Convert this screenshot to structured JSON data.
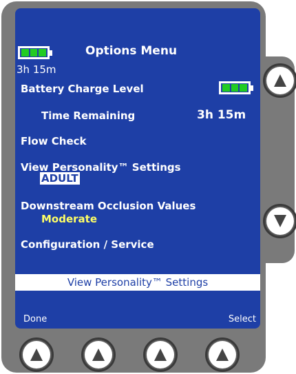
{
  "header": {
    "title": "Options Menu",
    "battery_time": "3h 15m"
  },
  "menu": {
    "battery_charge_label": "Battery Charge Level",
    "time_remaining_label": "Time Remaining",
    "time_remaining_value": "3h 15m",
    "flow_check": "Flow Check",
    "personality_label": "View Personality™ Settings",
    "personality_value": "ADULT",
    "occlusion_label": "Downstream Occlusion Values",
    "occlusion_value": "Moderate",
    "config_label": "Configuration / Service"
  },
  "selection_bar": "View Personality™ Settings",
  "softkeys": {
    "left": "Done",
    "right": "Select"
  },
  "icons": {
    "battery": "battery-full-icon",
    "up": "up-arrow-icon",
    "down": "down-arrow-icon"
  },
  "colors": {
    "screen_bg": "#1e3fa6",
    "battery_cells": "#22cc22",
    "occlusion_value": "#ffff66"
  }
}
